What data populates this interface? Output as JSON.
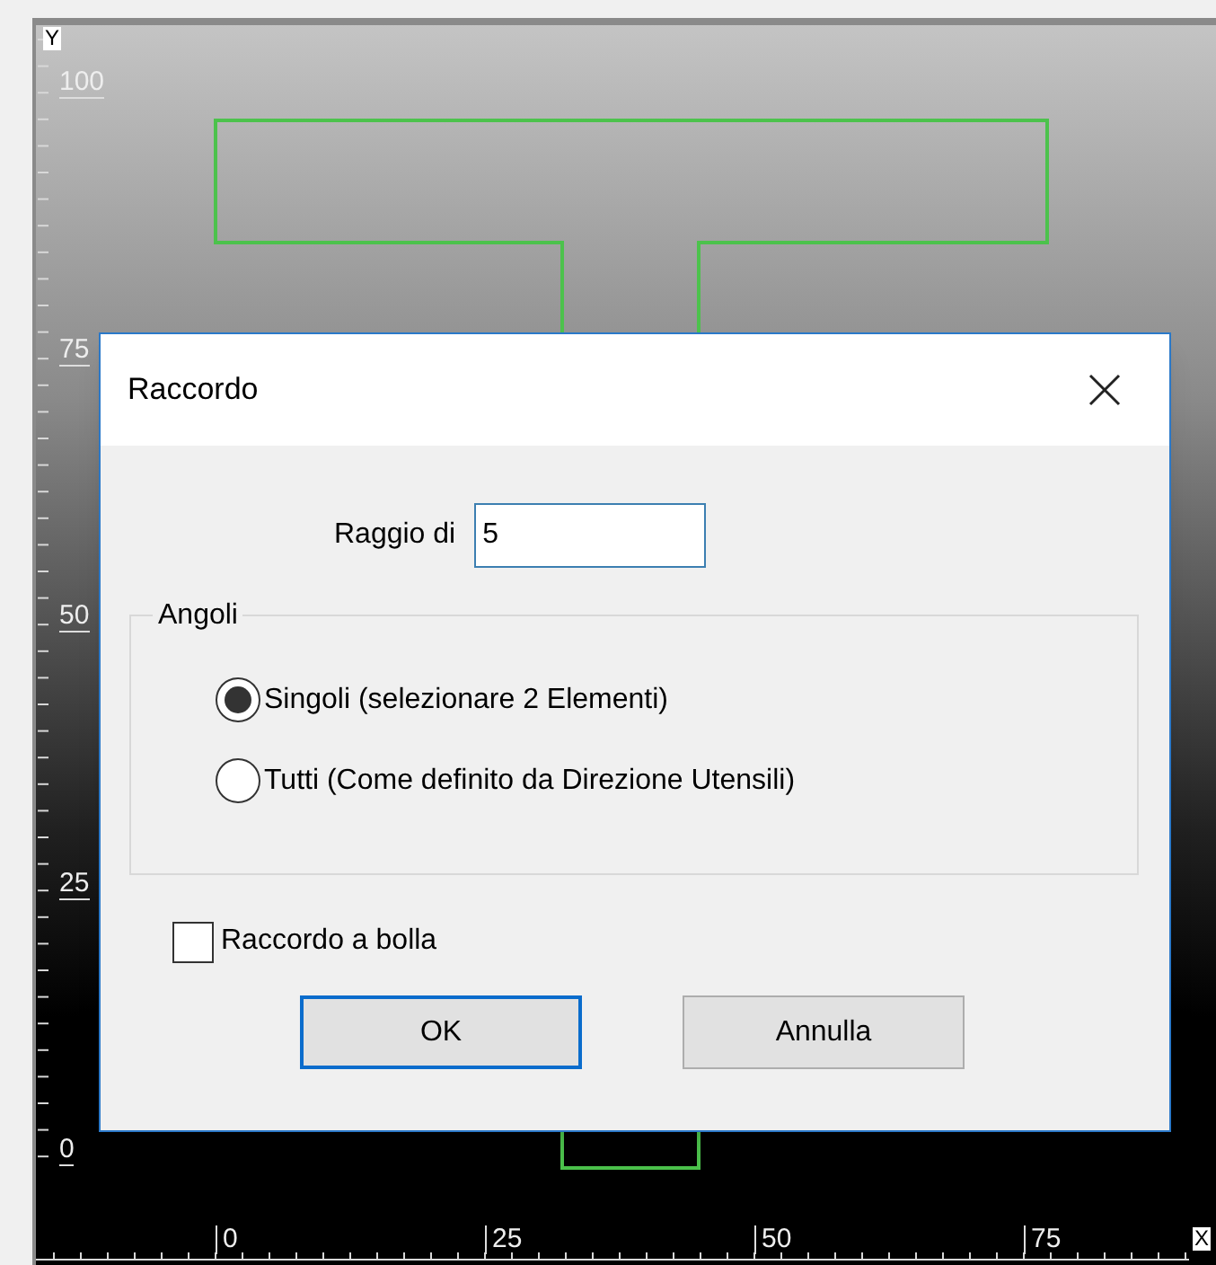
{
  "canvas": {
    "y_axis_label": "Y",
    "x_axis_label": "X",
    "y_ticks": [
      "100",
      "75",
      "50",
      "25",
      "0"
    ],
    "x_ticks": [
      "0",
      "25",
      "50",
      "75"
    ]
  },
  "dialog": {
    "title": "Raccordo",
    "radius": {
      "label": "Raggio di",
      "value": "5"
    },
    "group": {
      "title": "Angoli",
      "options": [
        {
          "label": "Singoli (selezionare 2 Elementi)",
          "selected": true
        },
        {
          "label": "Tutti (Come definito da Direzione Utensili)",
          "selected": false
        }
      ]
    },
    "checkbox": {
      "label": "Raccordo a bolla",
      "checked": false
    },
    "buttons": [
      {
        "label": "OK",
        "default": true
      },
      {
        "label": "Annulla",
        "default": false
      }
    ]
  }
}
